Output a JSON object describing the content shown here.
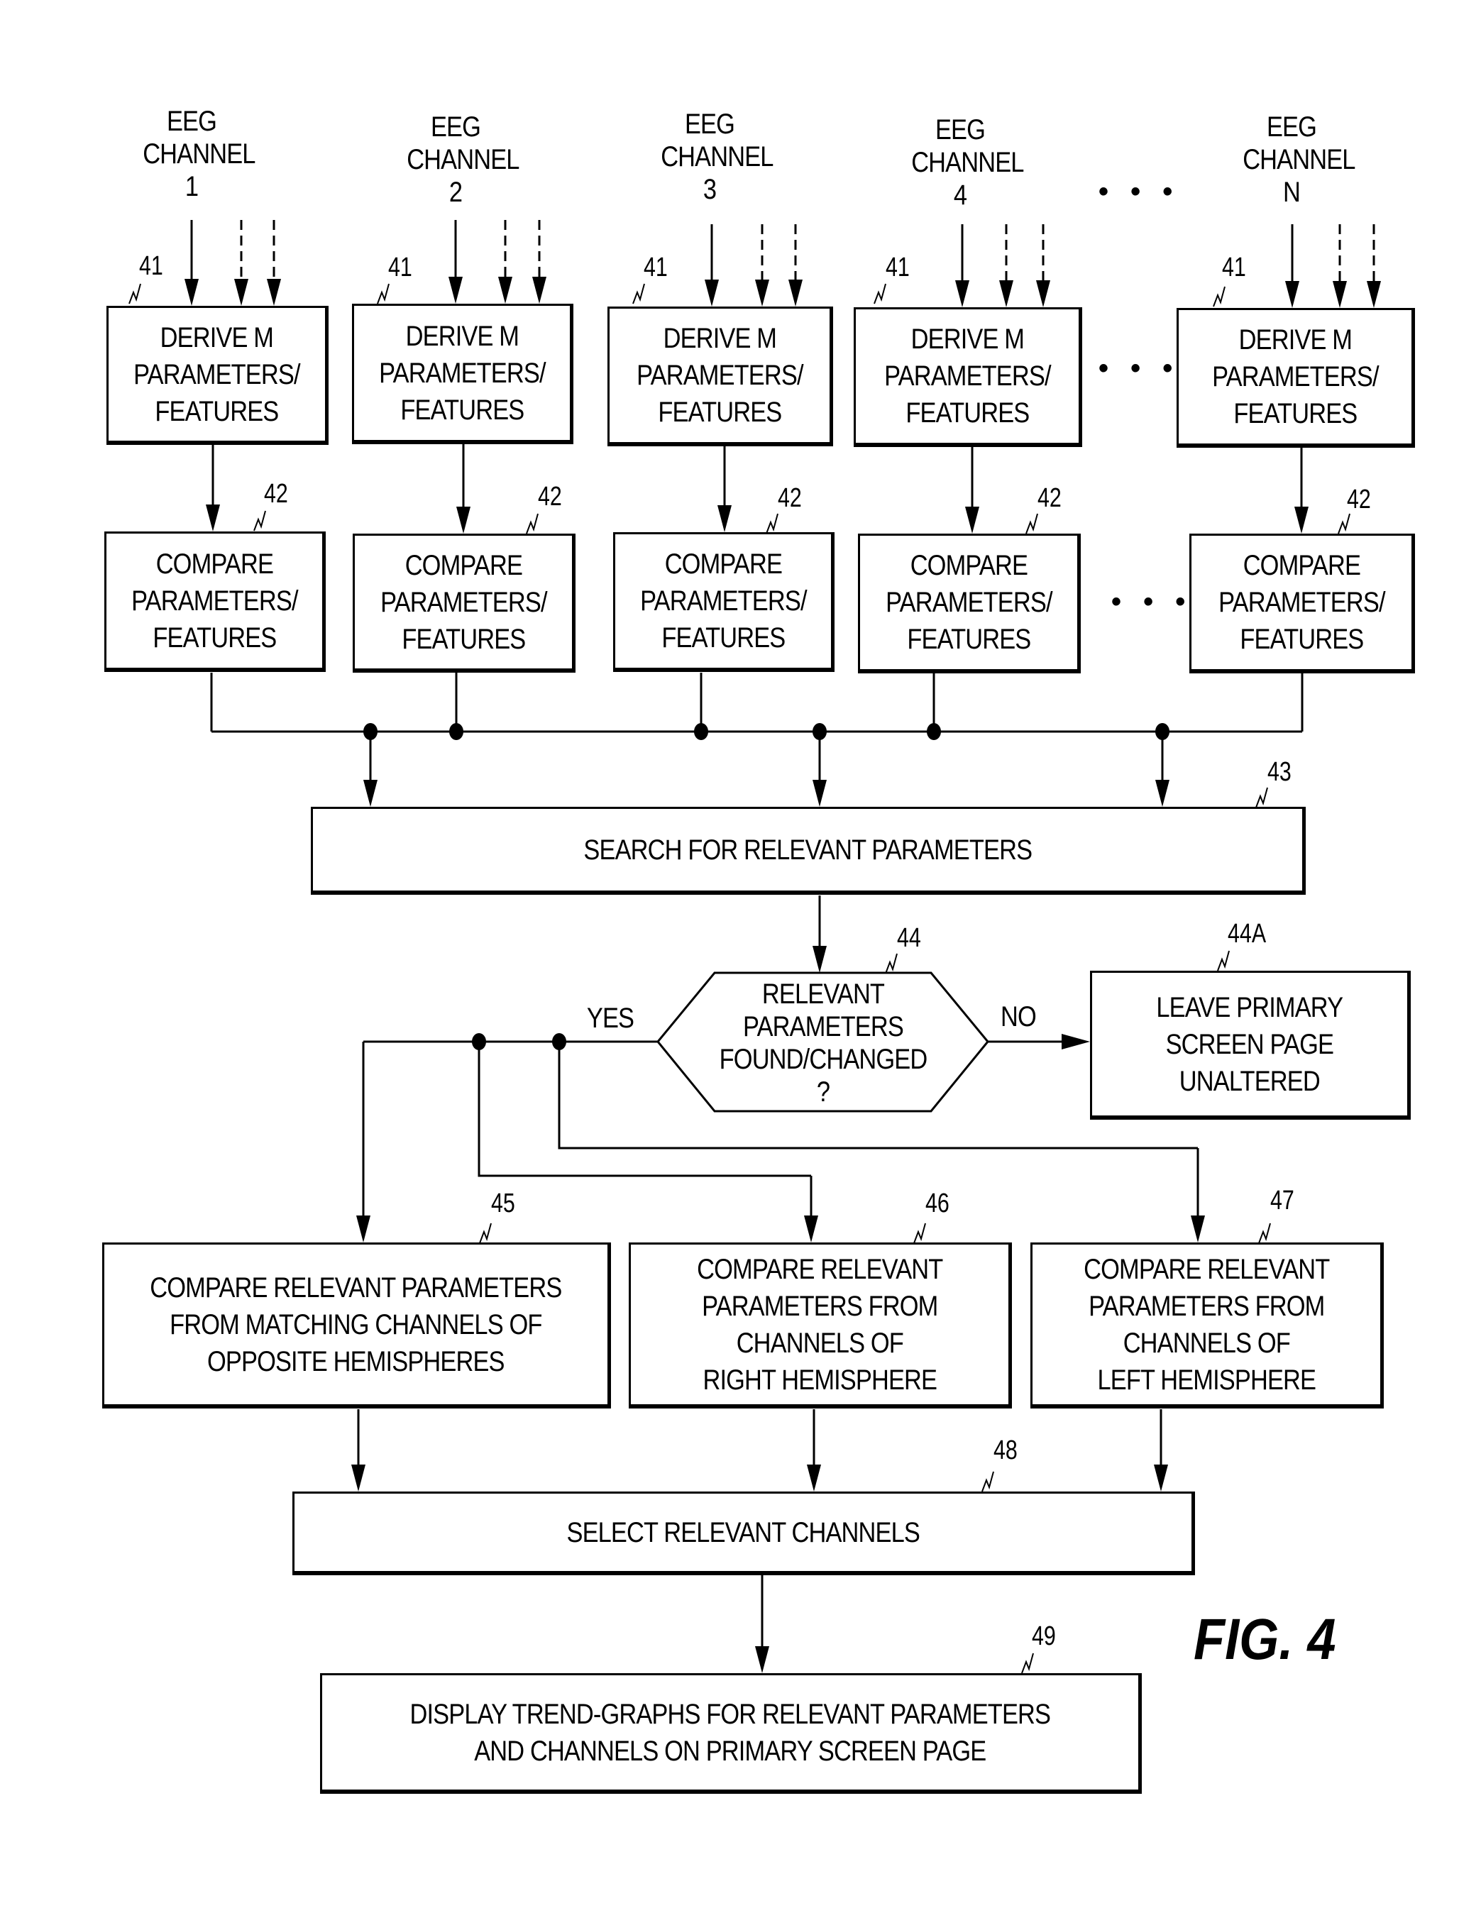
{
  "figure": {
    "label": "FIG. 4"
  },
  "channels": [
    {
      "title": "EEG\nCHANNEL\n1",
      "derive_ref": "41",
      "compare_ref": "42"
    },
    {
      "title": "EEG\nCHANNEL\n2",
      "derive_ref": "41",
      "compare_ref": "42"
    },
    {
      "title": "EEG\nCHANNEL\n3",
      "derive_ref": "41",
      "compare_ref": "42"
    },
    {
      "title": "EEG\nCHANNEL\n4",
      "derive_ref": "41",
      "compare_ref": "42"
    },
    {
      "title": "EEG\nCHANNEL\nN",
      "derive_ref": "41",
      "compare_ref": "42"
    }
  ],
  "ellipsis": "• • •",
  "blocks": {
    "derive": "DERIVE M\nPARAMETERS/\nFEATURES",
    "compare": "COMPARE\nPARAMETERS/\nFEATURES",
    "search": {
      "ref": "43",
      "text": "SEARCH FOR  RELEVANT PARAMETERS"
    },
    "decision": {
      "ref": "44",
      "text": "RELEVANT\nPARAMETERS\nFOUND/CHANGED\n?",
      "yes_label": "YES",
      "no_label": "NO"
    },
    "leave": {
      "ref": "44A",
      "text": "LEAVE PRIMARY\nSCREEN PAGE\nUNALTERED"
    },
    "opposite": {
      "ref": "45",
      "text": "COMPARE RELEVANT PARAMETERS\nFROM MATCHING CHANNELS OF\nOPPOSITE HEMISPHERES"
    },
    "right": {
      "ref": "46",
      "text": "COMPARE RELEVANT\nPARAMETERS FROM\nCHANNELS OF\nRIGHT HEMISPHERE"
    },
    "left": {
      "ref": "47",
      "text": "COMPARE  RELEVANT\nPARAMETERS FROM\nCHANNELS OF\nLEFT HEMISPHERE"
    },
    "select": {
      "ref": "48",
      "text": "SELECT RELEVANT CHANNELS"
    },
    "display": {
      "ref": "49",
      "text": "DISPLAY TREND-GRAPHS FOR RELEVANT PARAMETERS\nAND CHANNELS ON PRIMARY SCREEN PAGE"
    }
  }
}
